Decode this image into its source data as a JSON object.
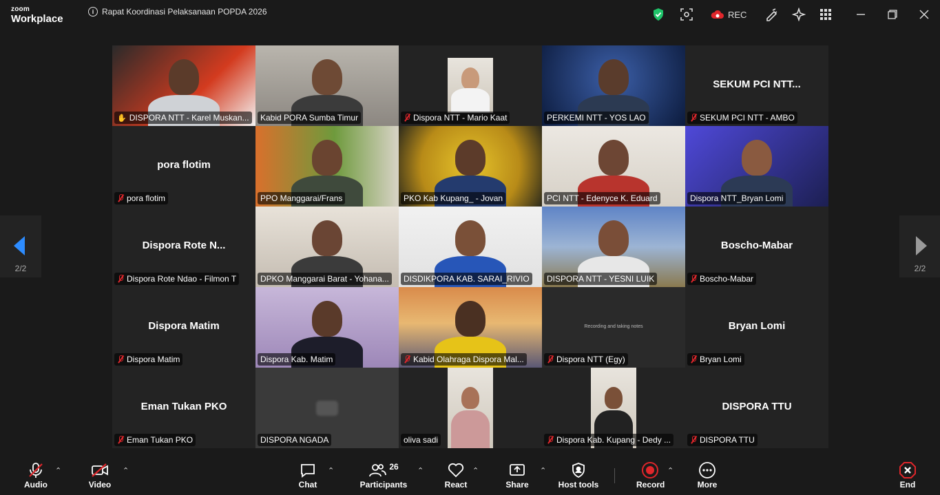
{
  "app": {
    "brand_top": "zoom",
    "brand_bottom": "Workplace",
    "meeting_title": "Rapat Koordinasi Pelaksanaan POPDA 2026",
    "rec_label": "REC"
  },
  "navigation": {
    "page_left": "2/2",
    "page_right": "2/2"
  },
  "tiles": [
    {
      "big": "",
      "label": "DISPORA NTT - Karel Muskan...",
      "video": true,
      "muted": false,
      "active": true
    },
    {
      "big": "",
      "label": "Kabid PORA Sumba Timur",
      "video": true,
      "muted": false
    },
    {
      "big": "",
      "label": "Dispora NTT - Mario Kaat",
      "video": true,
      "muted": true
    },
    {
      "big": "",
      "label": "PERKEMI  NTT - YOS LAO",
      "video": true,
      "muted": false
    },
    {
      "big": "SEKUM PCI NTT...",
      "label": "SEKUM PCI NTT - AMBO",
      "video": false,
      "muted": true
    },
    {
      "big": "pora flotim",
      "label": "pora flotim",
      "video": false,
      "muted": true
    },
    {
      "big": "",
      "label": "PPO Manggarai/Frans",
      "video": true,
      "muted": false
    },
    {
      "big": "",
      "label": "PKO Kab Kupang_ - Jovan",
      "video": true,
      "muted": false
    },
    {
      "big": "",
      "label": "PCI NTT - Edenyce K. Eduard",
      "video": true,
      "muted": false
    },
    {
      "big": "",
      "label": "Dispora NTT_Bryan Lomi",
      "video": true,
      "muted": false
    },
    {
      "big": "Dispora Rote N...",
      "label": "Dispora Rote Ndao - Filmon T",
      "video": false,
      "muted": true
    },
    {
      "big": "",
      "label": "DPKO Manggarai Barat - Yohana...",
      "video": true,
      "muted": false
    },
    {
      "big": "",
      "label": "DISDIKPORA KAB. SARAI_RIVIO",
      "video": true,
      "muted": false
    },
    {
      "big": "",
      "label": "DISPORA NTT - YESNI LUIK",
      "video": true,
      "muted": false
    },
    {
      "big": "Boscho-Mabar",
      "label": "Boscho-Mabar",
      "video": false,
      "muted": true
    },
    {
      "big": "Dispora Matim",
      "label": "Dispora Matim",
      "video": false,
      "muted": true
    },
    {
      "big": "",
      "label": "Dispora Kab. Matim",
      "video": true,
      "muted": false
    },
    {
      "big": "",
      "label": "Kabid Olahraga Dispora Mal...",
      "video": true,
      "muted": true
    },
    {
      "big": "",
      "label": "Dispora NTT (Egy)",
      "video": true,
      "muted": true,
      "screen_text": "Recording and taking notes"
    },
    {
      "big": "Bryan Lomi",
      "label": "Bryan Lomi",
      "video": false,
      "muted": true
    },
    {
      "big": "Eman Tukan PKO",
      "label": "Eman Tukan PKO",
      "video": false,
      "muted": true
    },
    {
      "big": "",
      "label": "DISPORA NGADA",
      "video": true,
      "muted": false
    },
    {
      "big": "",
      "label": "oliva sadi",
      "video": true,
      "muted": false
    },
    {
      "big": "",
      "label": "Dispora Kab. Kupang - Dedy ...",
      "video": true,
      "muted": true
    },
    {
      "big": "DISPORA TTU",
      "label": "DISPORA TTU",
      "video": false,
      "muted": true
    }
  ],
  "toolbar": {
    "audio": "Audio",
    "video": "Video",
    "chat": "Chat",
    "participants": "Participants",
    "participants_count": "26",
    "react": "React",
    "share": "Share",
    "host_tools": "Host tools",
    "record": "Record",
    "more": "More",
    "end": "End"
  },
  "colors": {
    "accent_green": "#23c552",
    "mute_red": "#e0262b",
    "end_red": "#e0262b",
    "shield_green": "#1fc46a"
  }
}
